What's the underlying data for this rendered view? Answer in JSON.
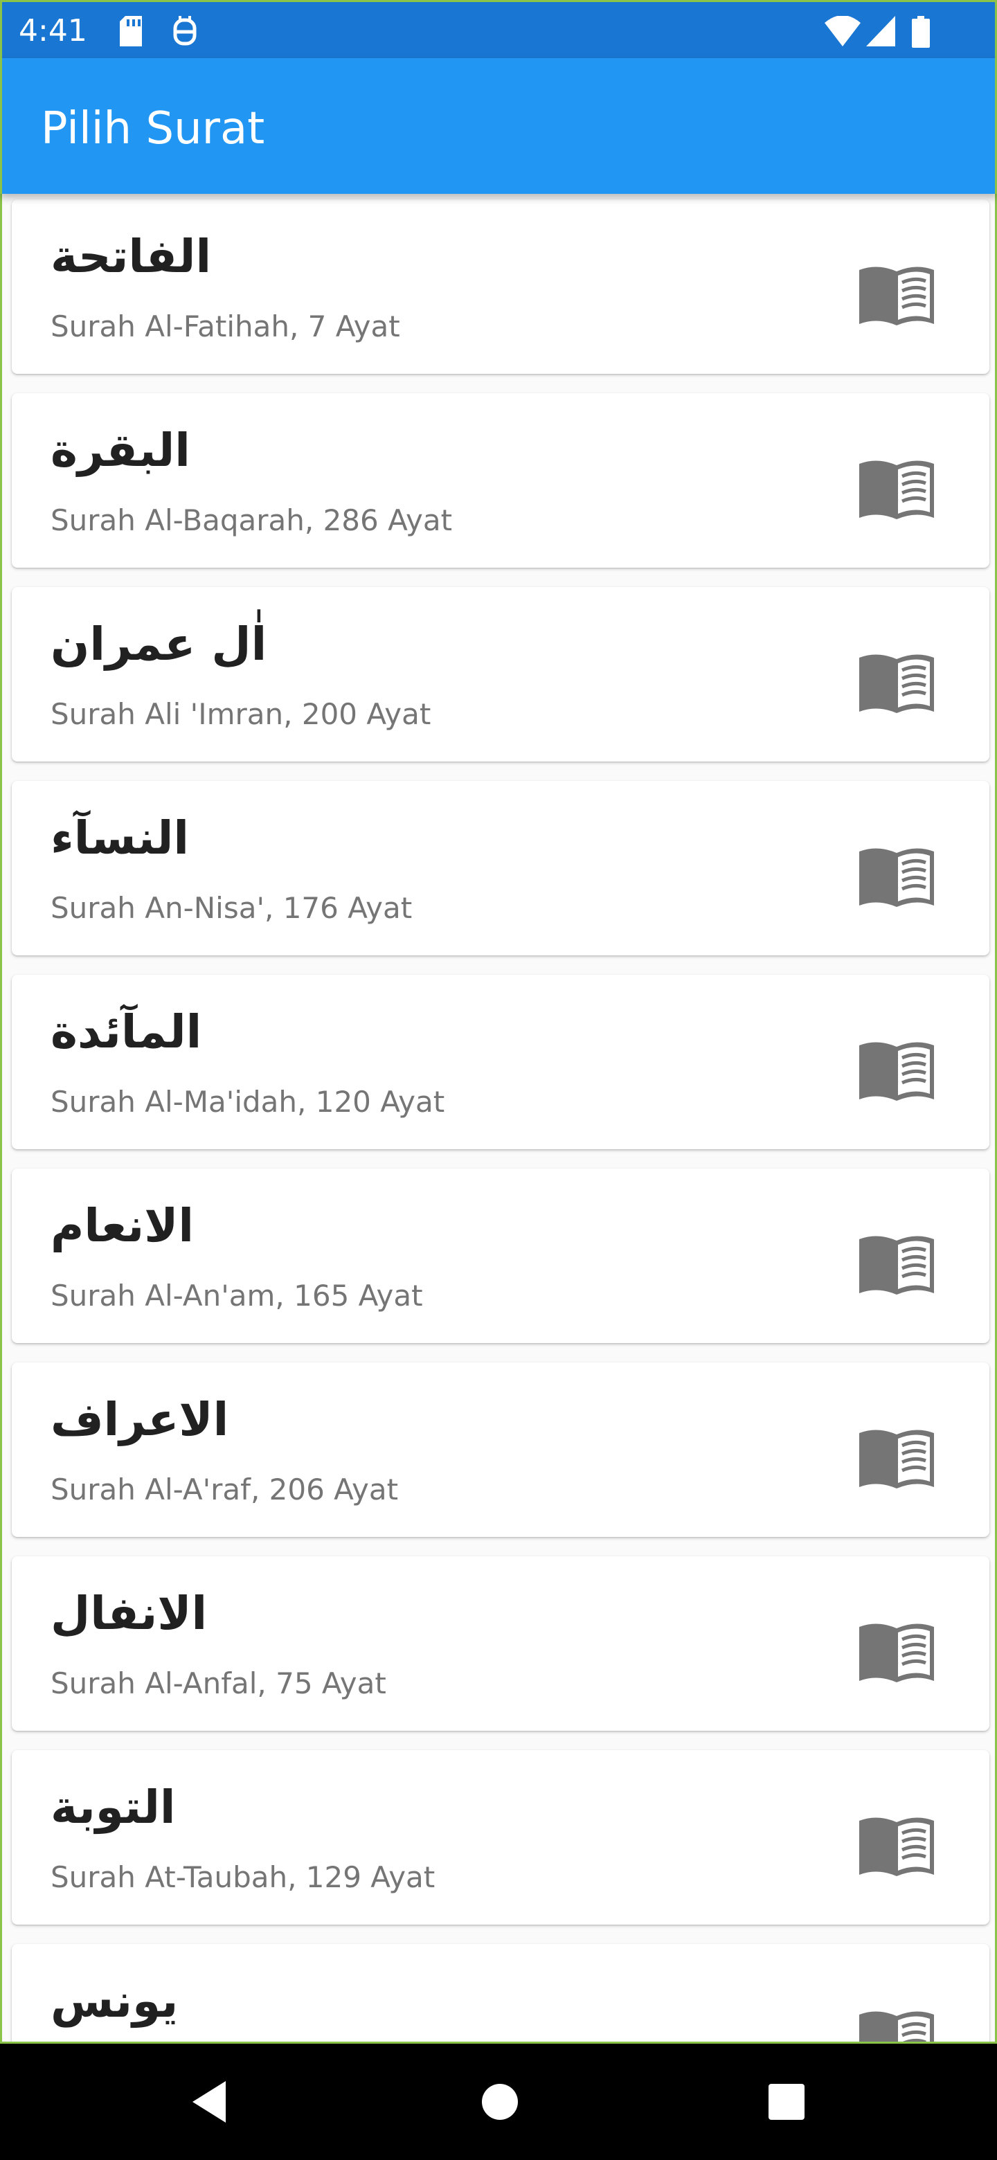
{
  "status_bar": {
    "time": "4:41",
    "icons": [
      "sd-card-icon",
      "robot-icon",
      "wifi-icon",
      "signal-icon",
      "battery-icon"
    ]
  },
  "app_bar": {
    "title": "Pilih Surat"
  },
  "surahs": [
    {
      "arabic": "الفاتحة",
      "latin": "Surah Al-Fatihah, 7 Ayat"
    },
    {
      "arabic": "البقرة",
      "latin": "Surah Al-Baqarah, 286 Ayat"
    },
    {
      "arabic": "اٰل عمران",
      "latin": "Surah Ali 'Imran, 200 Ayat"
    },
    {
      "arabic": "النسآء",
      "latin": "Surah An-Nisa', 176 Ayat"
    },
    {
      "arabic": "المآئدة",
      "latin": "Surah Al-Ma'idah, 120 Ayat"
    },
    {
      "arabic": "الانعام",
      "latin": "Surah Al-An'am, 165 Ayat"
    },
    {
      "arabic": "الاعراف",
      "latin": "Surah Al-A'raf, 206 Ayat"
    },
    {
      "arabic": "الانفال",
      "latin": "Surah Al-Anfal, 75 Ayat"
    },
    {
      "arabic": "التوبة",
      "latin": "Surah At-Taubah, 129 Ayat"
    },
    {
      "arabic": "يونس",
      "latin": ""
    }
  ],
  "nav": {
    "buttons": [
      "back-icon",
      "home-icon",
      "recents-icon"
    ]
  },
  "colors": {
    "primary": "#2196f3",
    "status_bar": "#1976d2",
    "icon_gray": "#757575"
  }
}
